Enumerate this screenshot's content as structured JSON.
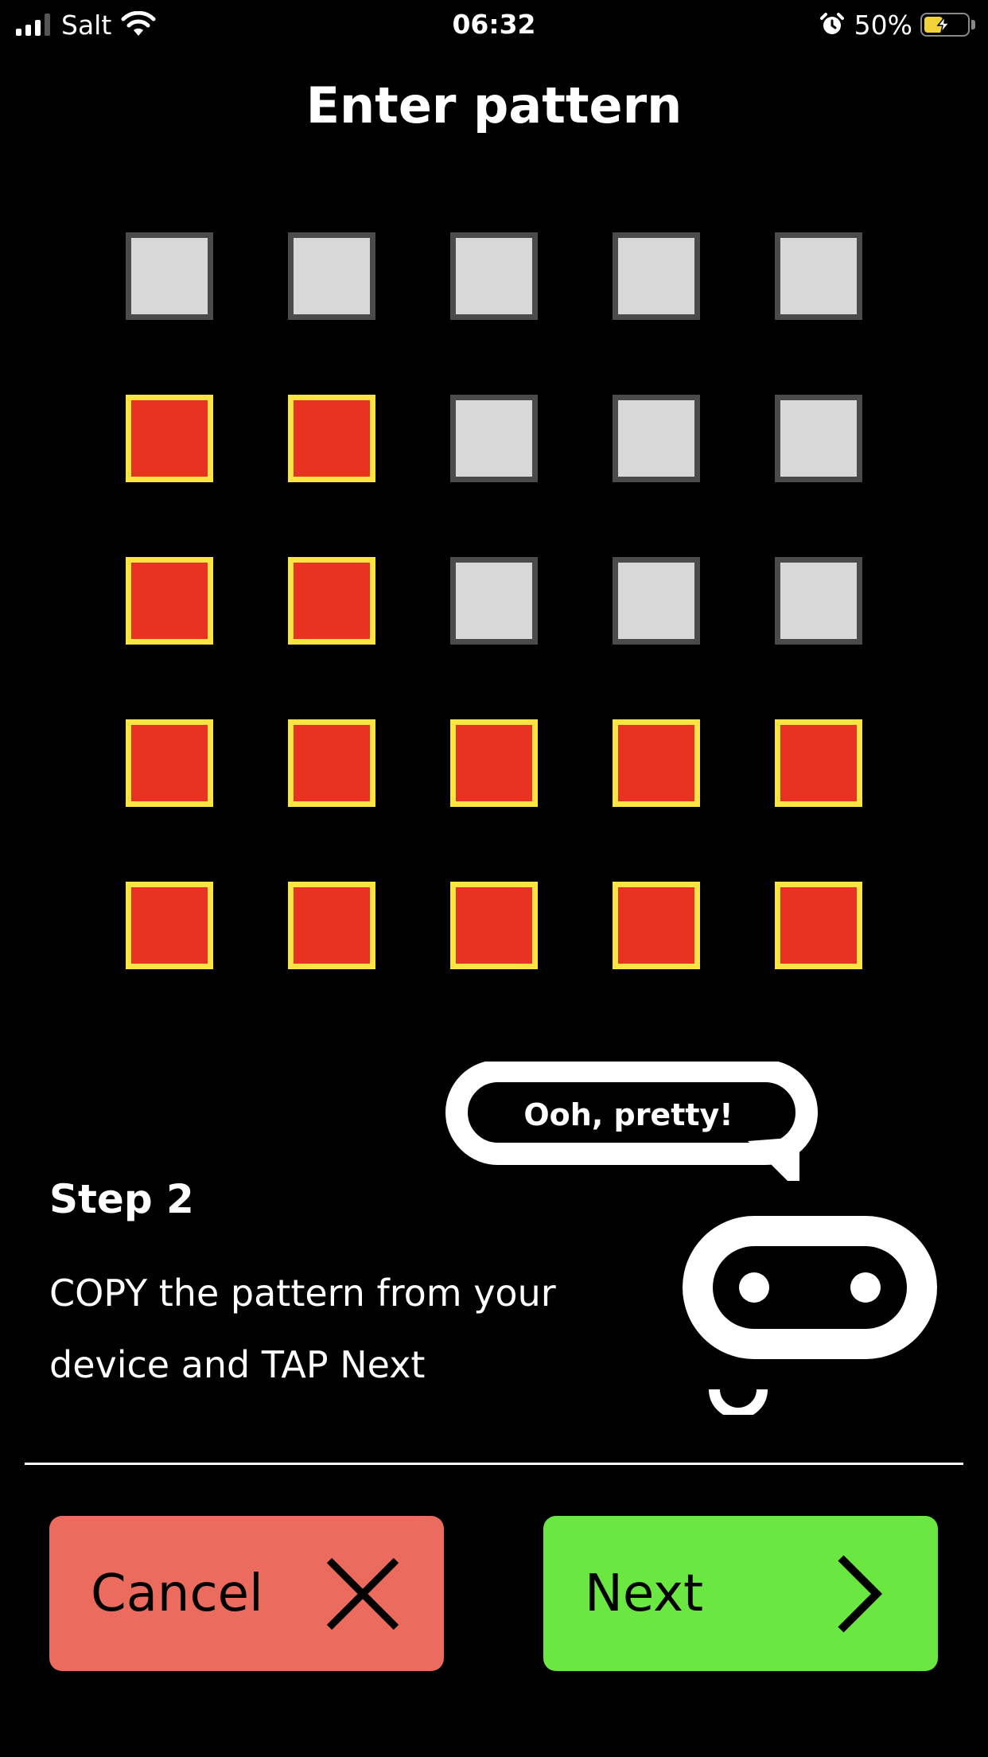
{
  "status_bar": {
    "carrier": "Salt",
    "time": "06:32",
    "battery_percent": "50%",
    "battery_level": 0.5,
    "signal_bars": 3,
    "icons": [
      "signal-icon",
      "wifi-icon",
      "alarm-icon",
      "battery-charging-icon"
    ]
  },
  "title": "Enter pattern",
  "pattern": {
    "rows": [
      [
        0,
        0,
        0,
        0,
        0
      ],
      [
        1,
        1,
        0,
        0,
        0
      ],
      [
        1,
        1,
        0,
        0,
        0
      ],
      [
        1,
        1,
        1,
        1,
        1
      ],
      [
        1,
        1,
        1,
        1,
        1
      ]
    ],
    "colors": {
      "on_fill": "#e83323",
      "on_border": "#fce443",
      "off_fill": "#d8d8d8",
      "off_border": "#4b4b4b"
    }
  },
  "mascot": {
    "speech": "Ooh, pretty!",
    "icon": "robot-face-icon"
  },
  "step": {
    "title": "Step 2",
    "line1": "COPY the pattern from your",
    "line2": "device and TAP Next"
  },
  "buttons": {
    "cancel_label": "Cancel",
    "cancel_icon": "close-icon",
    "cancel_color": "#ec6b5f",
    "next_label": "Next",
    "next_icon": "chevron-right-icon",
    "next_color": "#6be742"
  }
}
